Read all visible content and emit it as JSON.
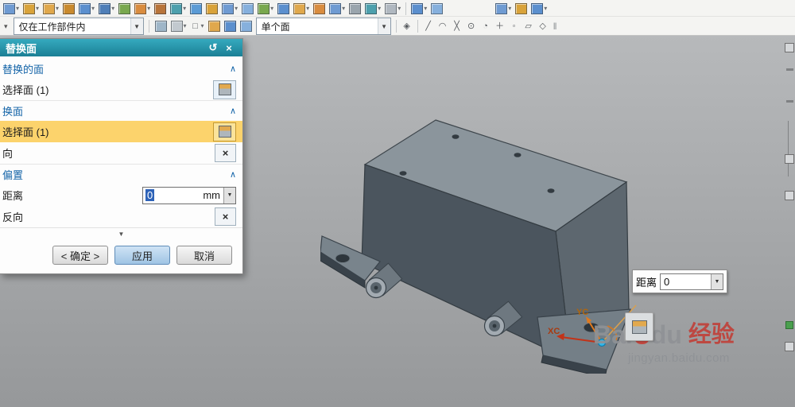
{
  "icons": {
    "close": "×",
    "reset": "↺",
    "collapse": "∧",
    "dropdown": "▼",
    "small_caret": "▾",
    "more_row": "▼",
    "reverse": "×",
    "grip": "‖"
  },
  "toolbars": {
    "row1": [
      {
        "name": "datum-plane-icon",
        "color": "#6f9bd2",
        "caret": true
      },
      {
        "name": "sketch-icon",
        "color": "#d9a33a",
        "caret": true
      },
      {
        "name": "extrude-icon",
        "color": "#e0a84c",
        "caret": true
      },
      {
        "name": "revolve-icon",
        "color": "#c98a2e"
      },
      {
        "name": "block-icon",
        "color": "#5b8fce",
        "caret": true
      },
      {
        "name": "hole-icon",
        "color": "#4f7fb8",
        "caret": true
      },
      {
        "name": "rib-icon",
        "color": "#79a84e"
      },
      {
        "name": "unite-icon",
        "color": "#d98c3f",
        "caret": true
      },
      {
        "name": "subtract-icon",
        "color": "#b8743a"
      },
      {
        "name": "edge-blend-icon",
        "color": "#4da0ad",
        "caret": true
      },
      {
        "name": "chamfer-icon",
        "color": "#5b9bd5"
      },
      {
        "name": "shell-icon",
        "color": "#d9a33a"
      },
      {
        "name": "trim-body-icon",
        "color": "#6f9bd2",
        "caret": true
      },
      {
        "name": "split-body-icon",
        "color": "#86b0dd"
      },
      {
        "name": "pattern-feature-icon",
        "color": "#79a84e",
        "caret": true
      },
      {
        "name": "mirror-feature-icon",
        "color": "#5b8fce"
      },
      {
        "name": "offset-face-icon",
        "color": "#e0a84c",
        "caret": true
      },
      {
        "name": "replace-face-icon",
        "color": "#d98c3f"
      },
      {
        "name": "move-face-icon",
        "color": "#6f9bd2",
        "caret": true
      },
      {
        "name": "delete-face-icon",
        "color": "#9aa5ad"
      },
      {
        "name": "synchronous-modeling-icon",
        "color": "#4da0ad",
        "caret": true
      },
      {
        "name": "measure-icon",
        "color": "#b0b8c0",
        "caret": true
      },
      {
        "sep": true
      },
      {
        "name": "view-orient-icon",
        "color": "#5b8fce",
        "caret": true
      },
      {
        "name": "render-style-icon",
        "color": "#86b0dd"
      },
      {
        "spacer": true
      },
      {
        "name": "window-icon",
        "color": "#6f9bd2",
        "caret": true
      },
      {
        "name": "assembly-icon",
        "color": "#d9a33a"
      },
      {
        "name": "more-tools-icon",
        "color": "#5b8fce",
        "caret": true
      }
    ],
    "row2": {
      "scope_combo_value": "仅在工作部件内",
      "face_rule_combo_value": "单个面",
      "pre_icons": [
        {
          "name": "selection-scope-icon",
          "color": "#9fb6c8"
        },
        {
          "name": "snap-settings-icon",
          "color": "#c2c9cf",
          "caret": true
        },
        {
          "name": "dashed-rect-icon",
          "glyph": "□",
          "caret": true
        },
        {
          "name": "work-part-cube-icon",
          "color": "#e0a84c"
        },
        {
          "name": "displayed-part-cube-icon",
          "color": "#5b8fce"
        },
        {
          "name": "component-cube-icon",
          "color": "#86b0dd"
        }
      ],
      "post_icons": [
        {
          "name": "highlight-face-icon",
          "glyph": "◈"
        },
        {
          "sep": true
        },
        {
          "name": "snap-endpoint-icon",
          "glyph": "╱"
        },
        {
          "name": "snap-midpoint-icon",
          "glyph": "◠"
        },
        {
          "name": "snap-intersection-icon",
          "glyph": "╳"
        },
        {
          "name": "snap-arc-center-icon",
          "glyph": "⊙"
        },
        {
          "name": "snap-quadrant-icon",
          "glyph": "◔"
        },
        {
          "name": "snap-point-icon",
          "glyph": "＋"
        },
        {
          "name": "snap-on-curve-icon",
          "glyph": "◦"
        },
        {
          "name": "snap-on-face-icon",
          "glyph": "▱"
        },
        {
          "name": "snap-grid-icon",
          "glyph": "◇"
        }
      ]
    }
  },
  "dialog": {
    "title": "替换面",
    "section_faces_to_replace": "替换的面",
    "select_face_1": "选择面 (1)",
    "section_replacement_face": "换面",
    "select_face_2": "选择面 (1)",
    "reverse_direction_label": "向",
    "section_offset": "偏置",
    "distance_label": "距离",
    "distance_value": "0",
    "distance_unit": "mm",
    "reverse_label": "反向",
    "ok_button": "< 确定 >",
    "apply_button": "应用",
    "cancel_button": "取消"
  },
  "viewport": {
    "distance_popup": {
      "label": "距离",
      "value": "0"
    },
    "triad": {
      "x_label": "XC",
      "y_label": "YC"
    },
    "watermark": {
      "brand_prefix": "Bai",
      "brand_suffix": "du",
      "brand_cn": "经验",
      "url": "jingyan.baidu.com"
    }
  }
}
